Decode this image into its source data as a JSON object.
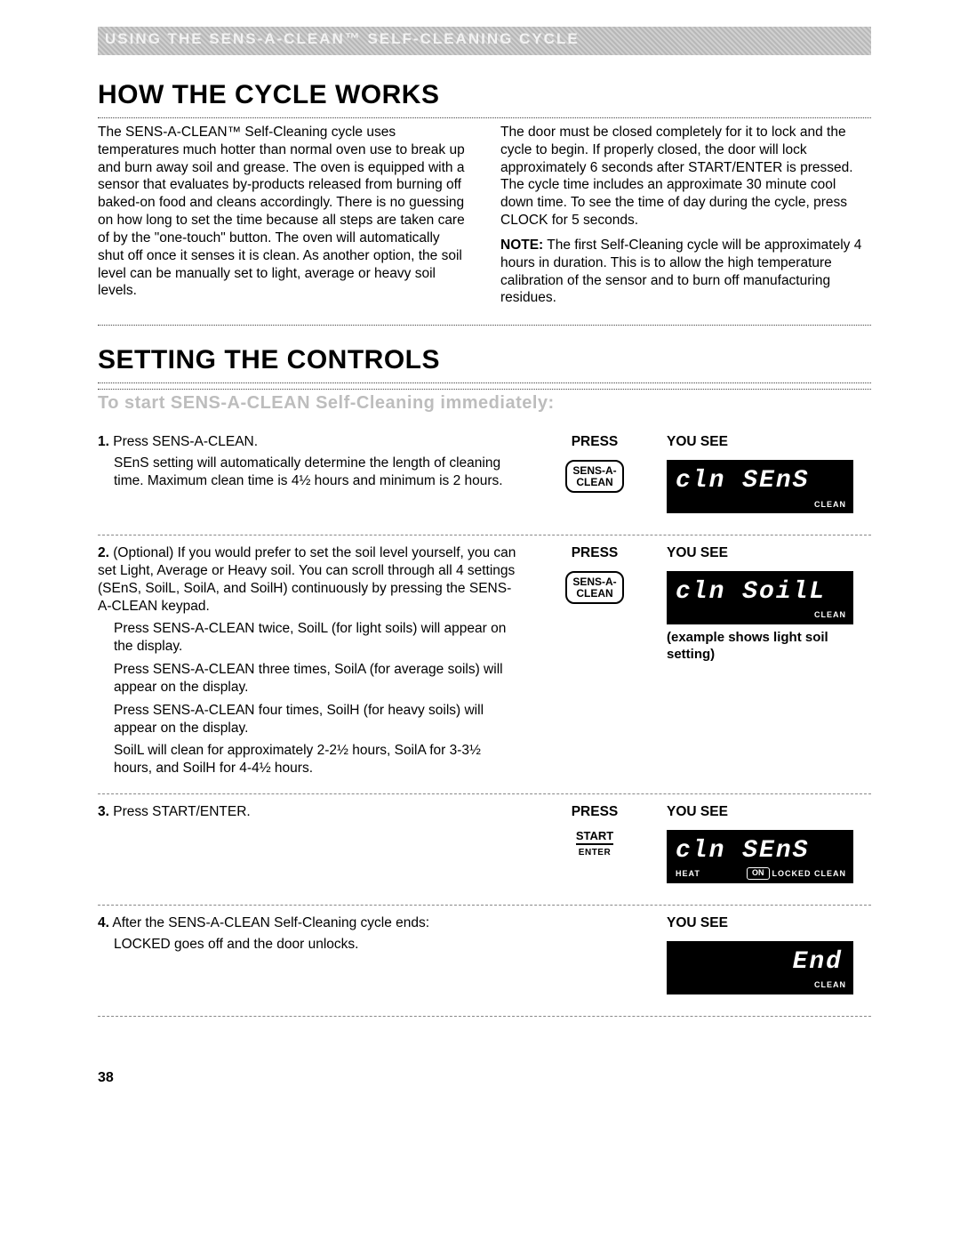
{
  "banner": "USING THE SENS-A-CLEAN™ SELF-CLEANING CYCLE",
  "h1_cycle": "HOW THE CYCLE WORKS",
  "cycle_col1": "The SENS-A-CLEAN™ Self-Cleaning cycle uses temperatures much hotter than normal oven use to break up and burn away soil and grease. The oven is equipped with a sensor that evaluates by-products released from burning off baked-on food and cleans accordingly. There is no guessing on how long to set the time because all steps are taken care of by the \"one-touch\" button. The oven will automatically shut off once it senses it is clean. As another option, the soil level can be manually set to light, average or heavy soil levels.",
  "cycle_col2a": "The door must be closed completely for it to lock and the cycle to begin. If properly closed, the door will lock approximately 6 seconds after START/ENTER is pressed. The cycle time includes an approximate 30 minute cool down time. To see the time of day during the cycle, press CLOCK for 5 seconds.",
  "cycle_note_label": "NOTE:",
  "cycle_note_body": " The first Self-Cleaning cycle will be approximately 4 hours in duration. This is to allow the high temperature calibration of the sensor and to burn off manufacturing residues.",
  "h1_controls": "SETTING THE CONTROLS",
  "sub_head": "To start SENS-A-CLEAN Self-Cleaning immediately:",
  "labels": {
    "press": "PRESS",
    "you_see": "YOU SEE"
  },
  "keypad": {
    "line1": "SENS-A-",
    "line2": "CLEAN"
  },
  "start": {
    "top": "START",
    "bot": "ENTER"
  },
  "step1": {
    "num": "1.",
    "lead": " Press SENS-A-CLEAN.",
    "sub": "SEnS setting will automatically determine the length of cleaning time. Maximum clean time is 4½ hours and minimum is 2 hours.",
    "disp_main": "cln SEnS",
    "disp_corner": "CLEAN"
  },
  "step2": {
    "num": "2.",
    "lead": " (Optional) If you would prefer to set the soil level yourself, you can set Light, Average or Heavy soil. You can scroll through all 4 settings (SEnS, SoilL, SoilA, and SoilH) continuously by pressing the SENS-A-CLEAN keypad.",
    "p1": "Press SENS-A-CLEAN twice, SoilL (for light soils) will appear on the display.",
    "p2": "Press SENS-A-CLEAN three times, SoilA (for average soils) will appear on the display.",
    "p3": "Press SENS-A-CLEAN four times, SoilH (for heavy soils) will appear on the display.",
    "p4": "SoilL will clean for approximately 2-2½ hours, SoilA for 3-3½ hours, and SoilH for 4-4½ hours.",
    "disp_main": "cln SoilL",
    "disp_corner": "CLEAN",
    "caption": "(example shows light soil setting)"
  },
  "step3": {
    "num": "3.",
    "lead": " Press START/ENTER.",
    "disp_main": "cln SEnS",
    "disp_bl": "HEAT",
    "disp_mid": "ON",
    "disp_corner": "LOCKED  CLEAN"
  },
  "step4": {
    "num": "4.",
    "lead": " After the SENS-A-CLEAN Self-Cleaning cycle ends:",
    "sub": "LOCKED goes off and the door unlocks.",
    "disp_main": "End",
    "disp_corner": "CLEAN"
  },
  "page_num": "38"
}
